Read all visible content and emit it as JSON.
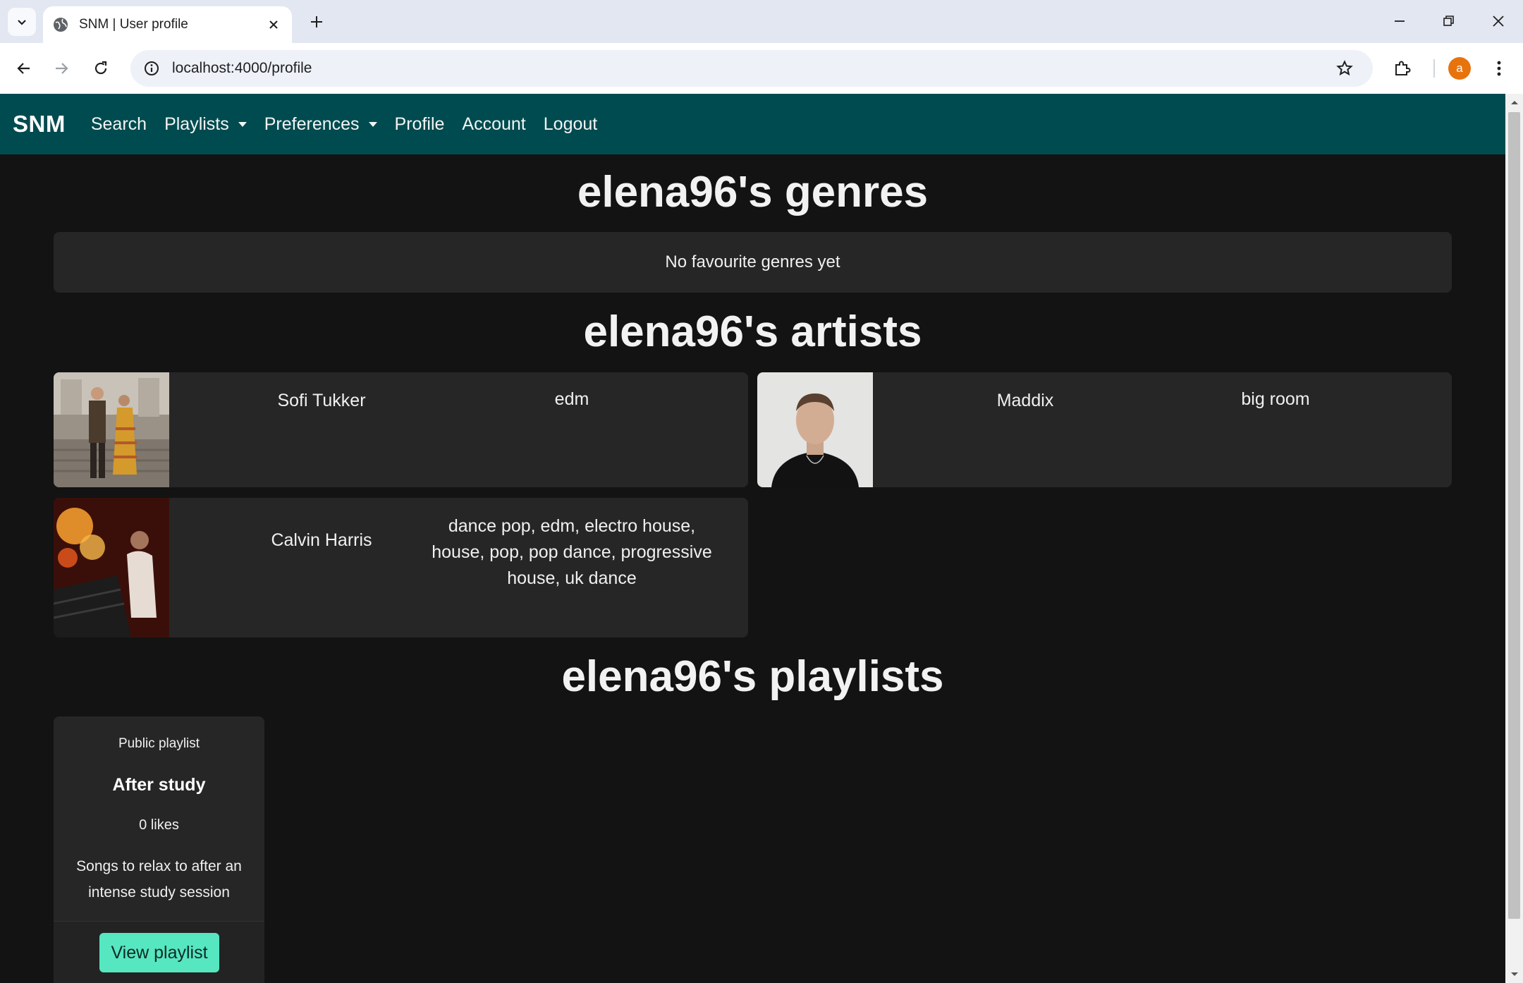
{
  "browser": {
    "tab_title": "SNM | User profile",
    "url": "localhost:4000/profile",
    "profile_initial": "a"
  },
  "navbar": {
    "brand": "SNM",
    "links": [
      "Search",
      "Playlists",
      "Preferences",
      "Profile",
      "Account",
      "Logout"
    ]
  },
  "genres": {
    "title": "elena96's genres",
    "empty_text": "No favourite genres yet"
  },
  "artists": {
    "title": "elena96's artists",
    "items": [
      {
        "name": "Sofi Tukker",
        "genres": "edm"
      },
      {
        "name": "Maddix",
        "genres": "big room"
      },
      {
        "name": "Calvin Harris",
        "genres": "dance pop, edm, electro house, house, pop, pop dance, progressive house, uk dance"
      }
    ]
  },
  "playlists": {
    "title": "elena96's playlists",
    "items": [
      {
        "type": "Public playlist",
        "name": "After study",
        "likes": "0 likes",
        "description": "Songs to relax to after an intense study session",
        "button": "View playlist"
      }
    ]
  },
  "colors": {
    "navbar_bg": "#004b4f",
    "page_bg": "#131313",
    "card_bg": "#262626",
    "button_accent": "#56e6c0"
  }
}
